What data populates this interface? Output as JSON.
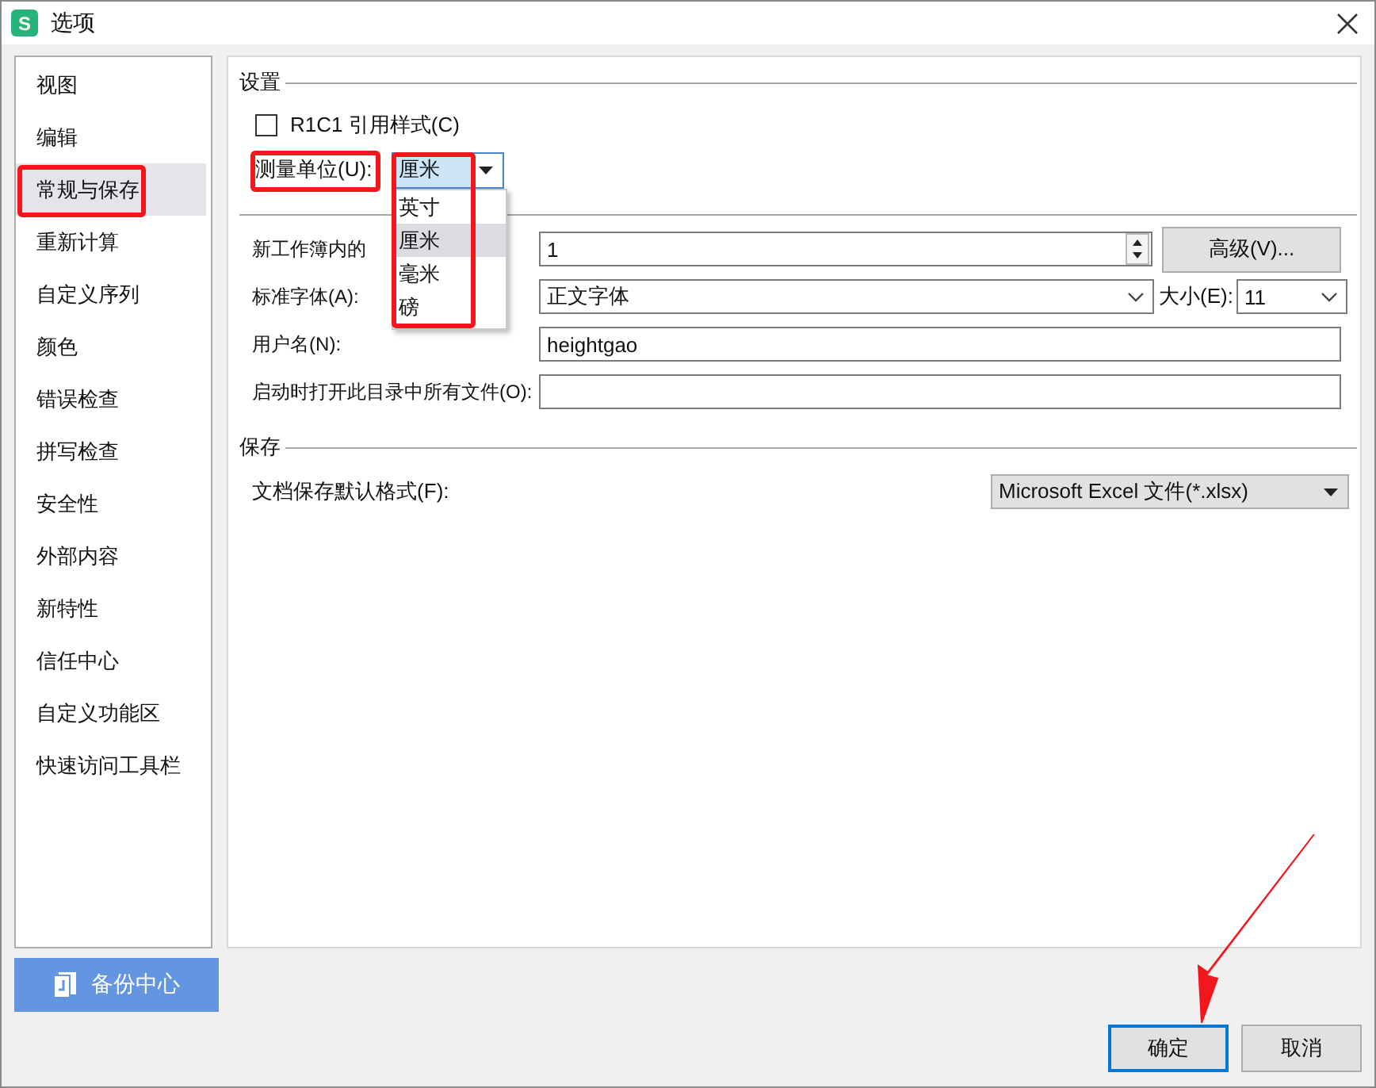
{
  "window": {
    "title": "选项",
    "icon_letter": "S"
  },
  "sidebar": {
    "items": [
      {
        "label": "视图",
        "selected": false,
        "highlighted": false
      },
      {
        "label": "编辑",
        "selected": false,
        "highlighted": false
      },
      {
        "label": "常规与保存",
        "selected": true,
        "highlighted": true
      },
      {
        "label": "重新计算",
        "selected": false,
        "highlighted": false
      },
      {
        "label": "自定义序列",
        "selected": false,
        "highlighted": false
      },
      {
        "label": "颜色",
        "selected": false,
        "highlighted": false
      },
      {
        "label": "错误检查",
        "selected": false,
        "highlighted": false
      },
      {
        "label": "拼写检查",
        "selected": false,
        "highlighted": false
      },
      {
        "label": "安全性",
        "selected": false,
        "highlighted": false
      },
      {
        "label": "外部内容",
        "selected": false,
        "highlighted": false
      },
      {
        "label": "新特性",
        "selected": false,
        "highlighted": false
      },
      {
        "label": "信任中心",
        "selected": false,
        "highlighted": false
      },
      {
        "label": "自定义功能区",
        "selected": false,
        "highlighted": false
      },
      {
        "label": "快速访问工具栏",
        "selected": false,
        "highlighted": false
      }
    ]
  },
  "backup_button": {
    "label": "备份中心"
  },
  "settings": {
    "heading": "设置",
    "r1c1": {
      "label": "R1C1 引用样式(C)",
      "checked": false
    },
    "measure_unit": {
      "label": "测量单位(U):",
      "label_highlighted": true,
      "value": "厘米",
      "expanded": true,
      "list_highlighted": true,
      "options": [
        {
          "label": "英寸",
          "selected": false
        },
        {
          "label": "厘米",
          "selected": true
        },
        {
          "label": "毫米",
          "selected": false
        },
        {
          "label": "磅",
          "selected": false
        }
      ]
    },
    "sheets": {
      "label": "新工作簿内的",
      "value": "1"
    },
    "advanced_button": {
      "label": "高级(V)..."
    },
    "font": {
      "label": "标准字体(A):",
      "value": "正文字体"
    },
    "size": {
      "label": "大小(E):",
      "value": "11"
    },
    "username": {
      "label": "用户名(N):",
      "value": "heightgao"
    },
    "startup_dir": {
      "label": "启动时打开此目录中所有文件(O):"
    }
  },
  "save": {
    "heading": "保存",
    "format": {
      "label": "文档保存默认格式(F):",
      "value": "Microsoft Excel 文件(*.xlsx)"
    }
  },
  "buttons": [
    {
      "label": "确定",
      "default": true,
      "pointed": true
    },
    {
      "label": "取消",
      "default": false,
      "pointed": false
    }
  ]
}
